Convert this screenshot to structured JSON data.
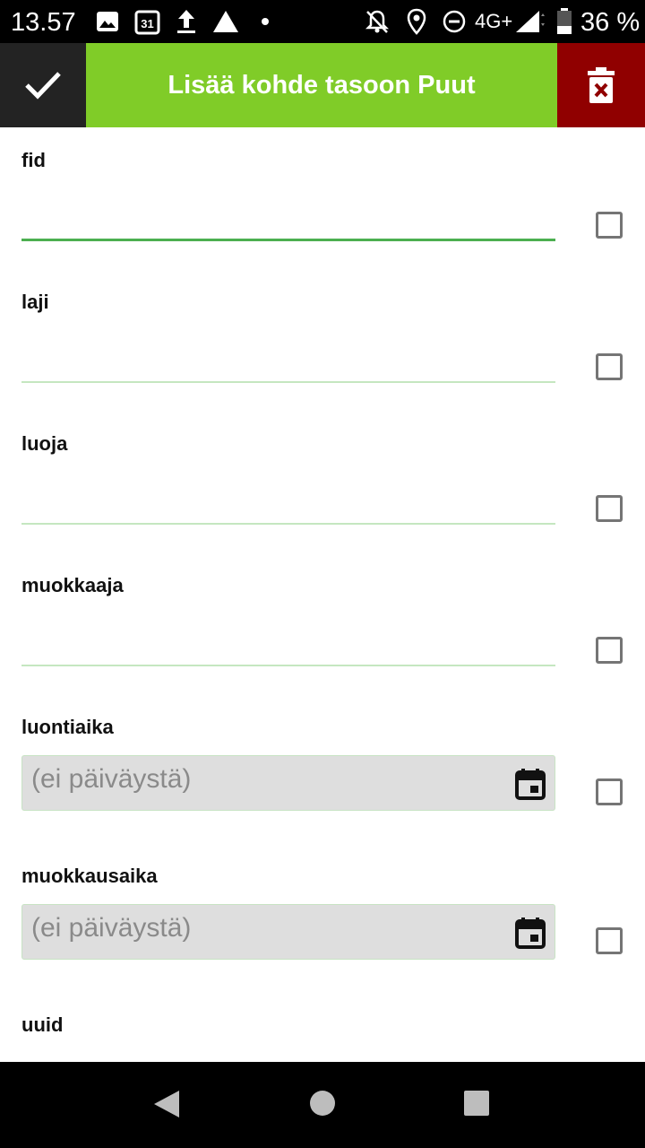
{
  "status_bar": {
    "time": "13.57",
    "network": "4G+",
    "battery": "36 %",
    "icons": [
      "image-icon",
      "calendar-icon",
      "upload-icon",
      "drive-icon",
      "dot-icon",
      "notifications-off-icon",
      "location-icon",
      "do-not-disturb-icon",
      "signal-icon",
      "battery-icon"
    ]
  },
  "toolbar": {
    "title": "Lisää kohde tasoon Puut",
    "accept_icon": "check-icon",
    "delete_icon": "delete-icon",
    "colors": {
      "accept_bg": "#232323",
      "title_bg": "#80cc28",
      "delete_bg": "#900000"
    }
  },
  "form": {
    "fields": [
      {
        "label": "fid",
        "type": "text",
        "value": ""
      },
      {
        "label": "laji",
        "type": "text",
        "value": ""
      },
      {
        "label": "luoja",
        "type": "text",
        "value": ""
      },
      {
        "label": "muokkaaja",
        "type": "text",
        "value": ""
      },
      {
        "label": "luontiaika",
        "type": "date",
        "value": "(ei päiväystä)"
      },
      {
        "label": "muokkausaika",
        "type": "date",
        "value": "(ei päiväystä)"
      },
      {
        "label": "uuid",
        "type": "text",
        "value": ""
      }
    ]
  },
  "nav_bar": {
    "icons": [
      "back-icon",
      "home-icon",
      "recents-icon"
    ]
  }
}
